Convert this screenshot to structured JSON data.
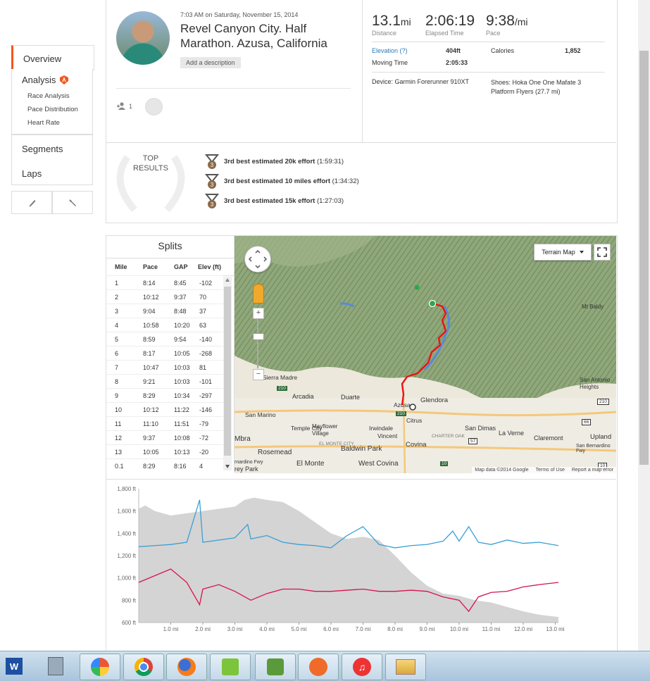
{
  "nav": {
    "overview": "Overview",
    "analysis": "Analysis",
    "analysis_sub": [
      "Race Analysis",
      "Pace Distribution",
      "Heart Rate"
    ],
    "segments": "Segments",
    "laps": "Laps"
  },
  "activity": {
    "datetime": "7:03 AM on Saturday, November 15, 2014",
    "title_line1": "Revel Canyon City. Half",
    "title_line2": "Marathon. Azusa, California",
    "add_description": "Add a description",
    "kudos_count": "1"
  },
  "stats": {
    "distance_value": "13.1",
    "distance_unit": "mi",
    "distance_label": "Distance",
    "elapsed_value": "2:06:19",
    "elapsed_label": "Elapsed Time",
    "pace_value": "9:38",
    "pace_unit": "/mi",
    "pace_label": "Pace",
    "elevation_label": "Elevation (?)",
    "elevation_value": "404ft",
    "calories_label": "Calories",
    "calories_value": "1,852",
    "moving_label": "Moving Time",
    "moving_value": "2:05:33",
    "device": "Device: Garmin Forerunner 910XT",
    "shoes_line1": "Shoes: Hoka One One Mafate 3",
    "shoes_line2": "Platform Flyers (27.7 mi)"
  },
  "top_results": {
    "heading_line1": "TOP",
    "heading_line2": "RESULTS",
    "items": [
      {
        "label": "3rd best estimated 20k effort",
        "time": "(1:59:31)"
      },
      {
        "label": "3rd best estimated 10 miles effort",
        "time": "(1:34:32)"
      },
      {
        "label": "3rd best estimated 15k effort",
        "time": "(1:27:03)"
      }
    ],
    "medal_rank": "3"
  },
  "splits": {
    "title": "Splits",
    "headers": [
      "Mile",
      "Pace",
      "GAP",
      "Elev (ft)"
    ],
    "rows": [
      [
        "1",
        "8:14",
        "8:45",
        "-102"
      ],
      [
        "2",
        "10:12",
        "9:37",
        "70"
      ],
      [
        "3",
        "9:04",
        "8:48",
        "37"
      ],
      [
        "4",
        "10:58",
        "10:20",
        "63"
      ],
      [
        "5",
        "8:59",
        "9:54",
        "-140"
      ],
      [
        "6",
        "8:17",
        "10:05",
        "-268"
      ],
      [
        "7",
        "10:47",
        "10:03",
        "81"
      ],
      [
        "8",
        "9:21",
        "10:03",
        "-101"
      ],
      [
        "9",
        "8:29",
        "10:34",
        "-297"
      ],
      [
        "10",
        "10:12",
        "11:22",
        "-146"
      ],
      [
        "11",
        "11:10",
        "11:51",
        "-79"
      ],
      [
        "12",
        "9:37",
        "10:08",
        "-72"
      ],
      [
        "13",
        "10:05",
        "10:13",
        "-20"
      ],
      [
        "0.1",
        "8:29",
        "8:16",
        "4"
      ]
    ]
  },
  "map": {
    "type_button": "Terrain Map",
    "places": [
      "Mt Baldy",
      "Sierra Madre",
      "Arcadia",
      "Duarte",
      "Glendora",
      "San Antonio Heights",
      "San Marino",
      "Temple City",
      "Mayflower Village",
      "Irwindale",
      "Citrus",
      "San Dimas",
      "La Verne",
      "Claremont",
      "Upland",
      "Rosemead",
      "Baldwin Park",
      "Vincent",
      "Covina",
      "El Monte",
      "West Covina",
      "EL MONTE CITY",
      "CHARTER OAK",
      "San Bernardino Fwy",
      "Azusa",
      "Mbra",
      "rey Park",
      "rnardino Fwy"
    ],
    "highways": [
      "210",
      "210",
      "210",
      "66",
      "57",
      "10",
      "10"
    ],
    "footer_data": "Map data ©2014 Google",
    "footer_terms": "Terms of Use",
    "footer_report": "Report a map error"
  },
  "chart_data": {
    "type": "area",
    "x_ticks": [
      "1.0 mi",
      "2.0 mi",
      "3.0 mi",
      "4.0 mi",
      "5.0 mi",
      "6.0 mi",
      "7.0 mi",
      "8.0 mi",
      "9.0 mi",
      "10.0 mi",
      "11.0 mi",
      "12.0 mi",
      "13.0 mi"
    ],
    "y_ticks": [
      "1,800 ft",
      "1,600 ft",
      "1,400 ft",
      "1,200 ft",
      "1,000 ft",
      "800 ft",
      "600 ft"
    ],
    "xlim": [
      0,
      13.1
    ],
    "ylim": [
      600,
      1800
    ],
    "colors": {
      "elevation": "#d4d4d4",
      "blue": "#3a9fd4",
      "red": "#d6134d"
    },
    "elevation": {
      "x": [
        0,
        0.2,
        0.5,
        1.0,
        1.5,
        2.0,
        2.5,
        3.0,
        3.3,
        3.6,
        4.0,
        4.5,
        5.0,
        5.5,
        6.0,
        6.5,
        7.0,
        7.5,
        8.0,
        8.5,
        9.0,
        9.5,
        10.0,
        10.5,
        11.0,
        11.5,
        12.0,
        12.5,
        13.1
      ],
      "y": [
        1620,
        1650,
        1600,
        1560,
        1580,
        1600,
        1620,
        1640,
        1700,
        1720,
        1700,
        1680,
        1600,
        1500,
        1400,
        1350,
        1370,
        1340,
        1200,
        1050,
        930,
        860,
        840,
        800,
        780,
        740,
        700,
        670,
        650
      ]
    },
    "blue_series": {
      "x": [
        0,
        0.5,
        1.0,
        1.5,
        1.9,
        2.0,
        2.5,
        3.0,
        3.4,
        3.5,
        4.0,
        4.5,
        5.0,
        5.5,
        6.0,
        6.5,
        7.0,
        7.5,
        8.0,
        8.5,
        9.0,
        9.5,
        9.8,
        10.0,
        10.3,
        10.6,
        11.0,
        11.5,
        12.0,
        12.5,
        13.1
      ],
      "y": [
        1280,
        1290,
        1300,
        1320,
        1700,
        1320,
        1340,
        1360,
        1480,
        1350,
        1380,
        1320,
        1300,
        1290,
        1270,
        1380,
        1460,
        1300,
        1270,
        1290,
        1300,
        1330,
        1420,
        1330,
        1460,
        1320,
        1300,
        1340,
        1310,
        1320,
        1290
      ]
    },
    "red_series": {
      "x": [
        0,
        0.5,
        1.0,
        1.5,
        1.9,
        2.0,
        2.5,
        3.0,
        3.5,
        4.0,
        4.5,
        5.0,
        5.5,
        6.0,
        6.5,
        7.0,
        7.5,
        8.0,
        8.5,
        9.0,
        9.5,
        10.0,
        10.3,
        10.6,
        11.0,
        11.5,
        12.0,
        12.5,
        13.1
      ],
      "y": [
        960,
        1020,
        1080,
        960,
        760,
        900,
        940,
        880,
        800,
        860,
        900,
        900,
        880,
        880,
        890,
        900,
        880,
        880,
        890,
        880,
        830,
        800,
        700,
        830,
        870,
        880,
        920,
        940,
        960
      ]
    }
  },
  "taskbar": {
    "apps": [
      "word-icon",
      "calculator-icon",
      "picasa-icon",
      "chrome-icon",
      "firefox-icon",
      "app-icon",
      "evernote-icon",
      "photo-app-icon",
      "itunes-icon",
      "explorer-icon"
    ]
  }
}
